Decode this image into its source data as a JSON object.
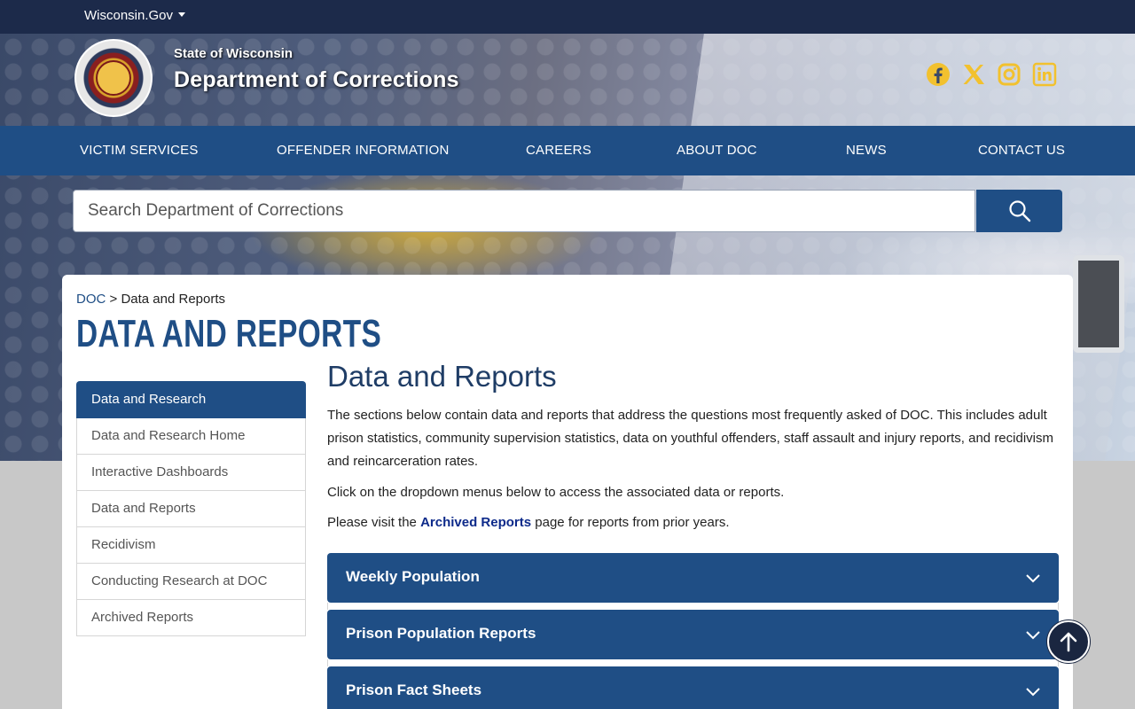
{
  "topbar": {
    "gov_label": "Wisconsin.Gov"
  },
  "header": {
    "state_name": "State of Wisconsin",
    "dept_name": "Department of Corrections",
    "social_icons": [
      "facebook-icon",
      "x-icon",
      "instagram-icon",
      "linkedin-icon"
    ],
    "accent_color": "#f2c12e"
  },
  "nav": {
    "items": [
      "VICTIM SERVICES",
      "OFFENDER INFORMATION",
      "CAREERS",
      "ABOUT DOC",
      "NEWS",
      "CONTACT US"
    ]
  },
  "search": {
    "placeholder": "Search Department of Corrections"
  },
  "breadcrumb": {
    "root": "DOC",
    "separator": ">",
    "current": "Data and Reports"
  },
  "page": {
    "title": "DATA AND REPORTS"
  },
  "sidebar": {
    "header": "Data and Research",
    "items": [
      "Data and Research Home",
      "Interactive Dashboards",
      "Data and Reports",
      "Recidivism",
      "Conducting Research at DOC",
      "Archived Reports"
    ]
  },
  "main": {
    "heading": "Data and Reports",
    "intro": "The sections below contain data and reports that address the questions most frequently asked of DOC. This includes adult prison statistics, community supervision statistics, data on youthful offenders, staff assault and injury reports, and recidivism and reincarceration rates.",
    "dropdown_note": "Click on the dropdown menus below to access the associated data or reports.",
    "archive_prefix": "Please visit the",
    "archive_link": "Archived Reports",
    "archive_suffix": "page for reports from prior years.",
    "accordions": [
      "Weekly Population",
      "Prison Population Reports",
      "Prison Fact Sheets"
    ]
  },
  "colors": {
    "primary": "#1f4e85",
    "topbar": "#1c2a4a"
  }
}
